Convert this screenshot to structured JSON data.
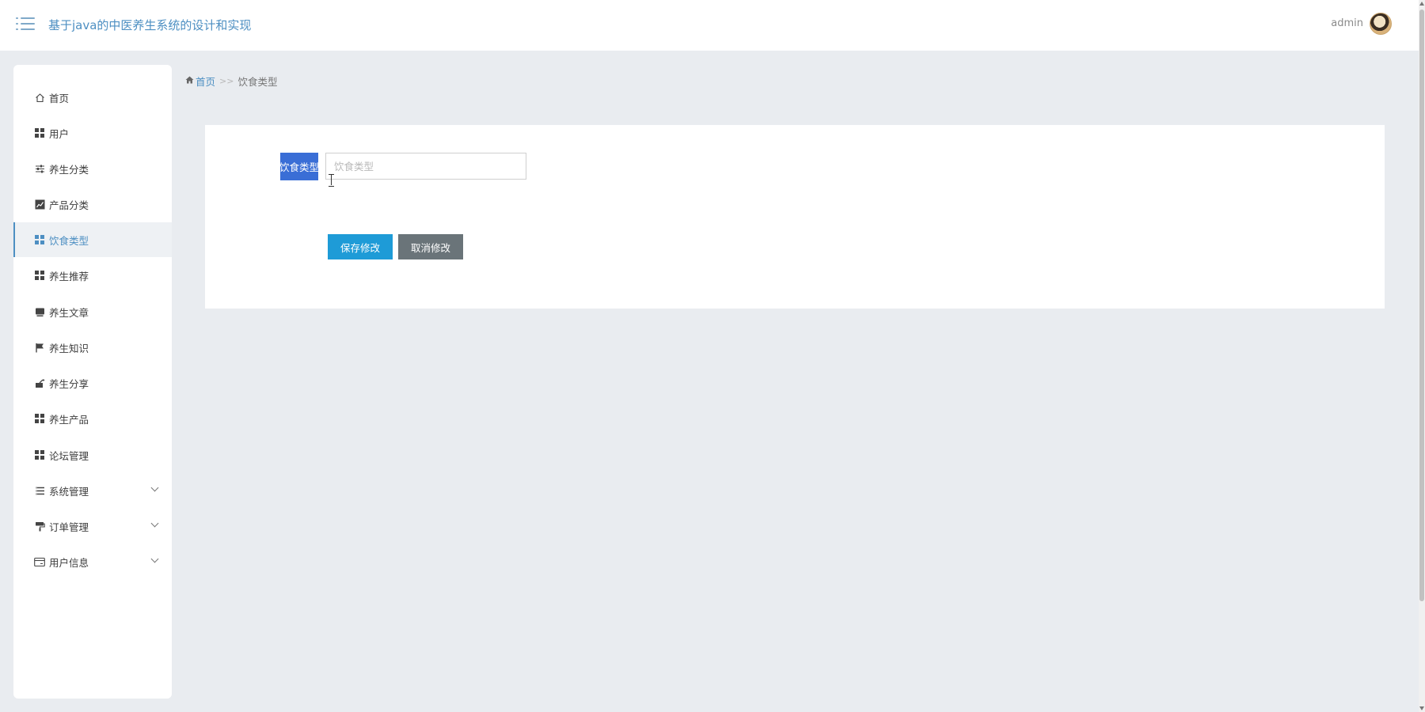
{
  "header": {
    "title": "基于java的中医养生系统的设计和实现",
    "username": "admin",
    "menu_icon": "menu-icon",
    "avatar_icon": "avatar"
  },
  "sidebar": {
    "items": [
      {
        "label": "首页",
        "icon": "home-icon"
      },
      {
        "label": "用户",
        "icon": "grid-icon"
      },
      {
        "label": "养生分类",
        "icon": "sliders-icon"
      },
      {
        "label": "产品分类",
        "icon": "chart-icon"
      },
      {
        "label": "饮食类型",
        "icon": "grid-icon",
        "active": true
      },
      {
        "label": "养生推荐",
        "icon": "grid-icon"
      },
      {
        "label": "养生文章",
        "icon": "monitor-icon"
      },
      {
        "label": "养生知识",
        "icon": "flag-icon"
      },
      {
        "label": "养生分享",
        "icon": "share-icon"
      },
      {
        "label": "养生产品",
        "icon": "grid-icon"
      },
      {
        "label": "论坛管理",
        "icon": "grid-icon"
      },
      {
        "label": "系统管理",
        "icon": "list-icon",
        "expandable": true
      },
      {
        "label": "订单管理",
        "icon": "paint-roller-icon",
        "expandable": true
      },
      {
        "label": "用户信息",
        "icon": "card-icon",
        "expandable": true
      }
    ],
    "active_color": "#4d8fc2"
  },
  "breadcrumb": {
    "home": "首页",
    "separator": ">>",
    "current": "饮食类型"
  },
  "form": {
    "field_label": "饮食类型",
    "field_value": "",
    "field_placeholder": "饮食类型",
    "save_label": "保存修改",
    "cancel_label": "取消修改"
  },
  "colors": {
    "accent": "#4d8fc2",
    "label_highlight": "#3a6ed6",
    "save_button": "#1e9bd7",
    "cancel_button": "#6a7479",
    "background": "#e9ecf0"
  }
}
